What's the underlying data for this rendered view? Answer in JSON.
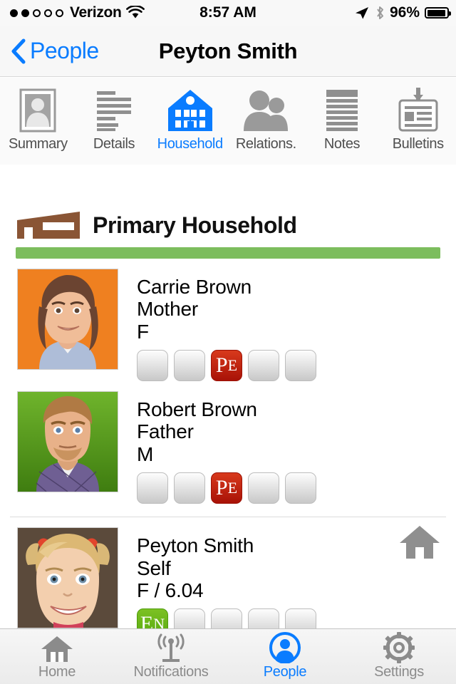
{
  "status_bar": {
    "carrier": "Verizon",
    "signal_dots_filled": 2,
    "signal_dots_total": 5,
    "wifi_icon": "wifi-icon",
    "time": "8:57 AM",
    "location_icon": "location-arrow-icon",
    "bluetooth_icon": "bluetooth-icon",
    "battery_percent": "96%",
    "battery_level": 96
  },
  "nav_bar": {
    "back_label": "People",
    "back_icon": "chevron-left-icon",
    "title": "Peyton Smith"
  },
  "segments": {
    "active_index": 2,
    "items": [
      {
        "label": "Summary",
        "icon": "portrait-photo-icon"
      },
      {
        "label": "Details",
        "icon": "text-lines-icon"
      },
      {
        "label": "Household",
        "icon": "house-building-icon"
      },
      {
        "label": "Relations.",
        "icon": "two-people-icon"
      },
      {
        "label": "Notes",
        "icon": "lined-document-icon"
      },
      {
        "label": "Bulletins",
        "icon": "id-badge-icon"
      }
    ]
  },
  "section": {
    "icon": "barn-house-icon",
    "title": "Primary Household",
    "progress_color": "#7cbd5d",
    "progress_percent": 100
  },
  "people": [
    {
      "name": "Carrie Brown",
      "relation": "Mother",
      "meta": "F",
      "avatar_bg": "#ef8020",
      "avatar_type": "illustrated-woman",
      "is_self": false,
      "badges": [
        {
          "label": "",
          "state": "empty"
        },
        {
          "label": "",
          "state": "empty"
        },
        {
          "label": "PE",
          "state": "active",
          "color": "#c41f0a"
        },
        {
          "label": "",
          "state": "empty"
        },
        {
          "label": "",
          "state": "empty"
        }
      ]
    },
    {
      "name": "Robert Brown",
      "relation": "Father",
      "meta": "M",
      "avatar_bg": "#5ba023",
      "avatar_type": "illustrated-man",
      "is_self": false,
      "badges": [
        {
          "label": "",
          "state": "empty"
        },
        {
          "label": "",
          "state": "empty"
        },
        {
          "label": "PE",
          "state": "active",
          "color": "#c41f0a"
        },
        {
          "label": "",
          "state": "empty"
        },
        {
          "label": "",
          "state": "empty"
        }
      ]
    },
    {
      "name": "Peyton Smith",
      "relation": "Self",
      "meta": "F / 6.04",
      "avatar_bg": "#6c5a49",
      "avatar_type": "photo-child",
      "is_self": true,
      "home_icon": "home-icon",
      "badges": [
        {
          "label": "EN",
          "state": "active",
          "color": "#62b015"
        },
        {
          "label": "",
          "state": "empty"
        },
        {
          "label": "",
          "state": "empty"
        },
        {
          "label": "",
          "state": "empty"
        },
        {
          "label": "",
          "state": "empty"
        }
      ]
    }
  ],
  "tab_bar": {
    "active_index": 2,
    "items": [
      {
        "label": "Home",
        "icon": "home-icon"
      },
      {
        "label": "Notifications",
        "icon": "broadcast-tower-icon"
      },
      {
        "label": "People",
        "icon": "person-circle-icon"
      },
      {
        "label": "Settings",
        "icon": "gear-icon"
      }
    ]
  },
  "colors": {
    "accent": "#0a7cff",
    "inactive": "#8b8b8b",
    "green": "#7cbd5d",
    "red": "#c41f0a"
  }
}
